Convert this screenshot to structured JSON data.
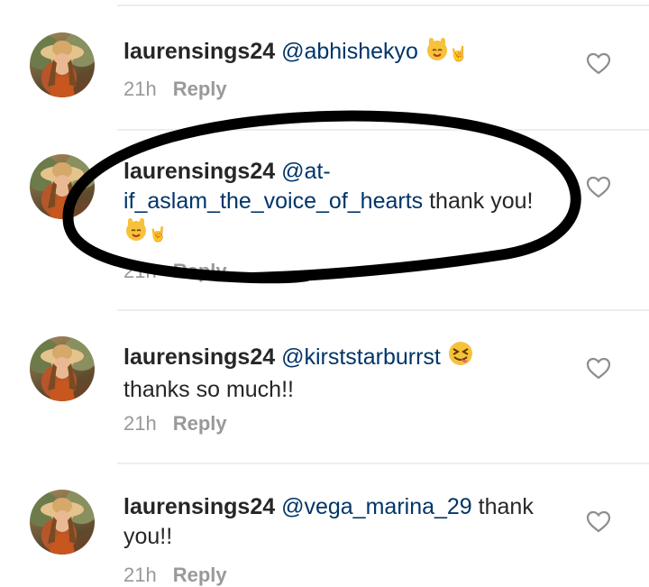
{
  "comments": [
    {
      "username": "laurensings24",
      "mention": "@abhishekyo",
      "mention_cont": "",
      "text": "",
      "trail": "🤘",
      "time": "21h",
      "reply_label": "Reply"
    },
    {
      "username": "laurensings24",
      "mention": "@at-",
      "mention_cont": "if_aslam_the_voice_of_hearts",
      "text": " thank you!",
      "trail": "🤘",
      "time": "21h",
      "reply_label": "Reply"
    },
    {
      "username": "laurensings24",
      "mention": "@kirststarburrst",
      "mention_cont": "",
      "text": "thanks so much!!",
      "trail": "",
      "time": "21h",
      "reply_label": "Reply"
    },
    {
      "username": "laurensings24",
      "mention": "@vega_marina_29",
      "mention_cont": "",
      "text": " thank you!!",
      "trail": "",
      "time": "21h",
      "reply_label": "Reply"
    }
  ],
  "icons": {
    "heart": "heart-outline-icon",
    "rock_emoji": "rock-on-emoji-icon",
    "tongue_emoji": "squinting-tongue-emoji-icon"
  },
  "colors": {
    "mention": "#003569",
    "meta": "#999999",
    "scribble": "#000000"
  }
}
